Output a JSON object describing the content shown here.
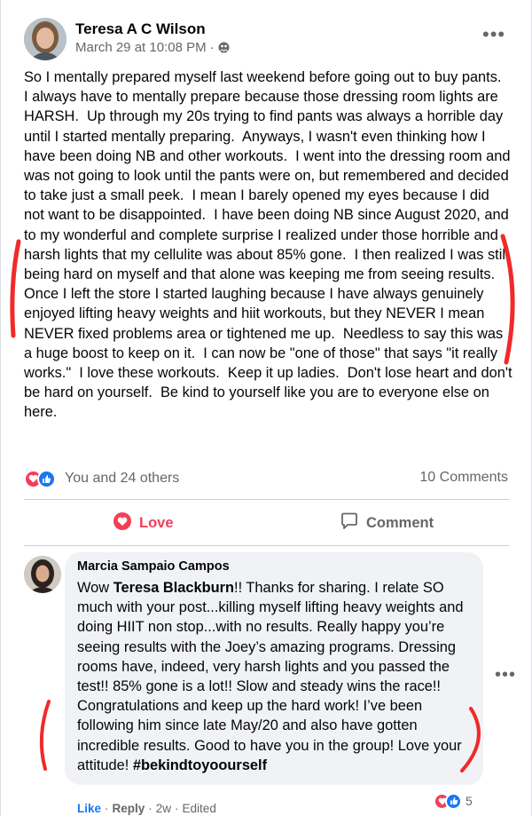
{
  "post": {
    "author": "Teresa A C Wilson",
    "timestamp": "March 29 at 10:08 PM",
    "separator": "·",
    "audience_icon": "group-icon",
    "more_label": "•••",
    "body": "So I mentally prepared myself last weekend before going out to buy pants.  I always have to mentally prepare because those dressing room lights are HARSH.  Up through my 20s trying to find pants was always a horrible day until I started mentally preparing.  Anyways, I wasn't even thinking how I have been doing NB and other workouts.  I went into the dressing room and was not going to look until the pants were on, but remembered and decided to take just a small peek.  I mean I barely opened my eyes because I did not want to be disappointed.  I have been doing NB since August 2020, and to my wonderful and complete surprise I realized under those horrible and harsh lights that my cellulite was about 85% gone.  I then realized I was still being hard on myself and that alone was keeping me from seeing results.  Once I left the store I started laughing because I have always genuinely enjoyed lifting heavy weights and hiit workouts, but they NEVER I mean NEVER fixed problems area or tightened me up.  Needless to say this was a huge boost to keep on it.  I can now be \"one of those\" that says \"it really works.\"  I love these workouts.  Keep it up ladies.  Don't lose heart and don't be hard on yourself.  Be kind to yourself like you are to everyone else on here.",
    "reactions_label": "You and 24 others",
    "comments_label": "10 Comments",
    "love_label": "Love",
    "comment_label": "Comment"
  },
  "comment": {
    "author": "Marcia Sampaio Campos",
    "text_prefix": "Wow ",
    "mention": "Teresa Blackburn",
    "text_mid": "!! Thanks for sharing. I relate SO much with your post...killing myself lifting heavy weights and doing HIIT non stop...with no results. Really happy you’re seeing results with the Joey’s amazing programs. Dressing rooms have, indeed, very harsh lights and you passed the test!! 85% gone is a lot!! Slow and steady wins the race!! Congratulations and keep up the hard work! I’ve been following him since late May/20 and also have gotten incredible results. Good to have you in the group! Love your attitude! ",
    "hashtag": "#bekindtoyoourself",
    "reaction_count": "5",
    "like_label": "Like",
    "reply_label": "Reply",
    "age": "2w",
    "edited_label": "Edited",
    "dot": "·"
  },
  "colors": {
    "love": "#f33e58",
    "like": "#1877f2",
    "secondary_text": "#65676b",
    "bubble": "#f0f2f5",
    "annotation": "#f02a2a"
  }
}
